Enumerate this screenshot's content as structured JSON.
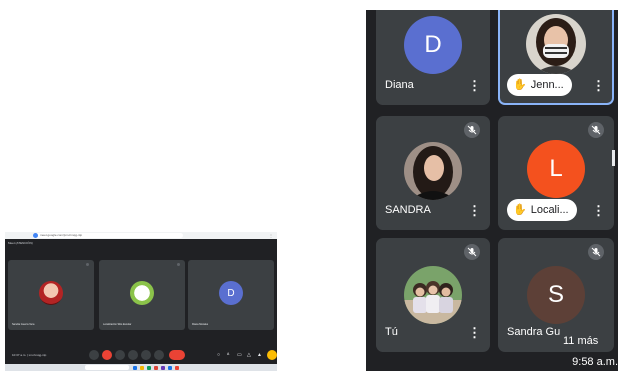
{
  "thumbnail": {
    "title_bar_text": "Meet (ATENCIÓN)",
    "url_text": "meet.google.com/jxm-hmqg-ntp",
    "participants": [
      {
        "name": "Sandra Guerra Vera"
      },
      {
        "name": "Localización Sitio Escolar"
      },
      {
        "name": "Diana Morales",
        "initial": "D"
      }
    ],
    "meeting_info": "10:37 a.m. | xm-hmqg-ntp",
    "end_call_icon": "end-call-icon"
  },
  "meet": {
    "participants": [
      {
        "name": "Diana",
        "initial": "D",
        "color": "#5a6fd0"
      },
      {
        "name": "Jenn...",
        "hand_raised": true
      },
      {
        "name": "SANDRA",
        "muted": true
      },
      {
        "name": "Locali...",
        "initial": "L",
        "color": "#f4511e",
        "hand_raised": true,
        "muted": true
      },
      {
        "name": "Tú",
        "muted": true
      },
      {
        "name": "Sandra Gu",
        "initial": "S",
        "color": "#5d4037",
        "muted": true
      }
    ],
    "more_participants": "11 más",
    "clock": "9:58 a.m.",
    "icons": {
      "menu": "more-vert-icon",
      "muted": "mic-off-icon",
      "hand": "raised-hand-icon"
    },
    "accent": "#8ab4f8"
  }
}
